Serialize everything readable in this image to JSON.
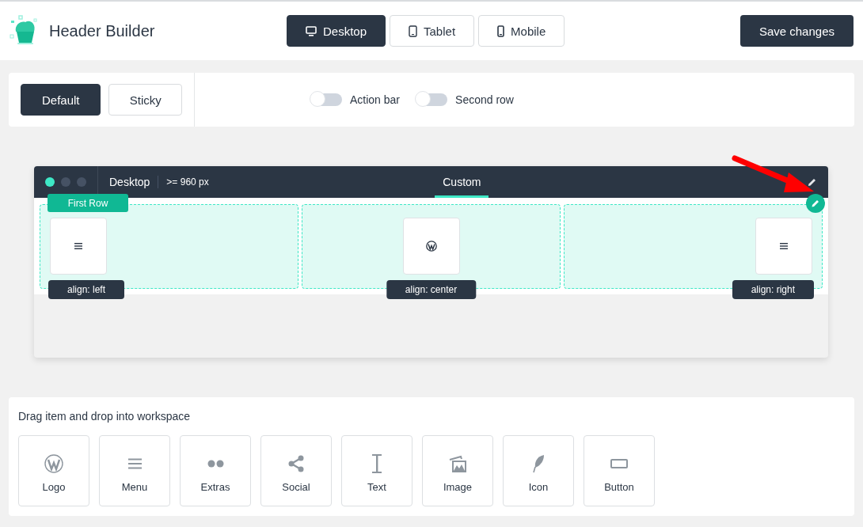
{
  "header": {
    "title": "Header Builder",
    "devices": [
      {
        "label": "Desktop",
        "kind": "desktop",
        "selected": true
      },
      {
        "label": "Tablet",
        "kind": "tablet",
        "selected": false
      },
      {
        "label": "Mobile",
        "kind": "mobile",
        "selected": false
      }
    ],
    "save_button": "Save changes"
  },
  "toolbar": {
    "modes": [
      {
        "label": "Default",
        "selected": true
      },
      {
        "label": "Sticky",
        "selected": false
      }
    ],
    "toggles": [
      {
        "label": "Action bar",
        "on": false
      },
      {
        "label": "Second row",
        "on": false
      }
    ]
  },
  "workspace": {
    "device": "Desktop",
    "breakpoint": ">= 960 px",
    "tab": "Custom",
    "row_label": "First Row",
    "cells": [
      {
        "kind": "left",
        "align_label": "align: left",
        "item": {
          "kind": "menu"
        }
      },
      {
        "kind": "center",
        "align_label": "align: center",
        "item": {
          "kind": "logo"
        }
      },
      {
        "kind": "right",
        "align_label": "align: right",
        "item": {
          "kind": "menu"
        }
      }
    ]
  },
  "palette": {
    "title": "Drag item and drop into workspace",
    "items": [
      {
        "label": "Logo",
        "kind": "logo"
      },
      {
        "label": "Menu",
        "kind": "menu"
      },
      {
        "label": "Extras",
        "kind": "extras"
      },
      {
        "label": "Social",
        "kind": "social"
      },
      {
        "label": "Text",
        "kind": "text"
      },
      {
        "label": "Image",
        "kind": "image"
      },
      {
        "label": "Icon",
        "kind": "icon"
      },
      {
        "label": "Button",
        "kind": "button"
      }
    ]
  }
}
